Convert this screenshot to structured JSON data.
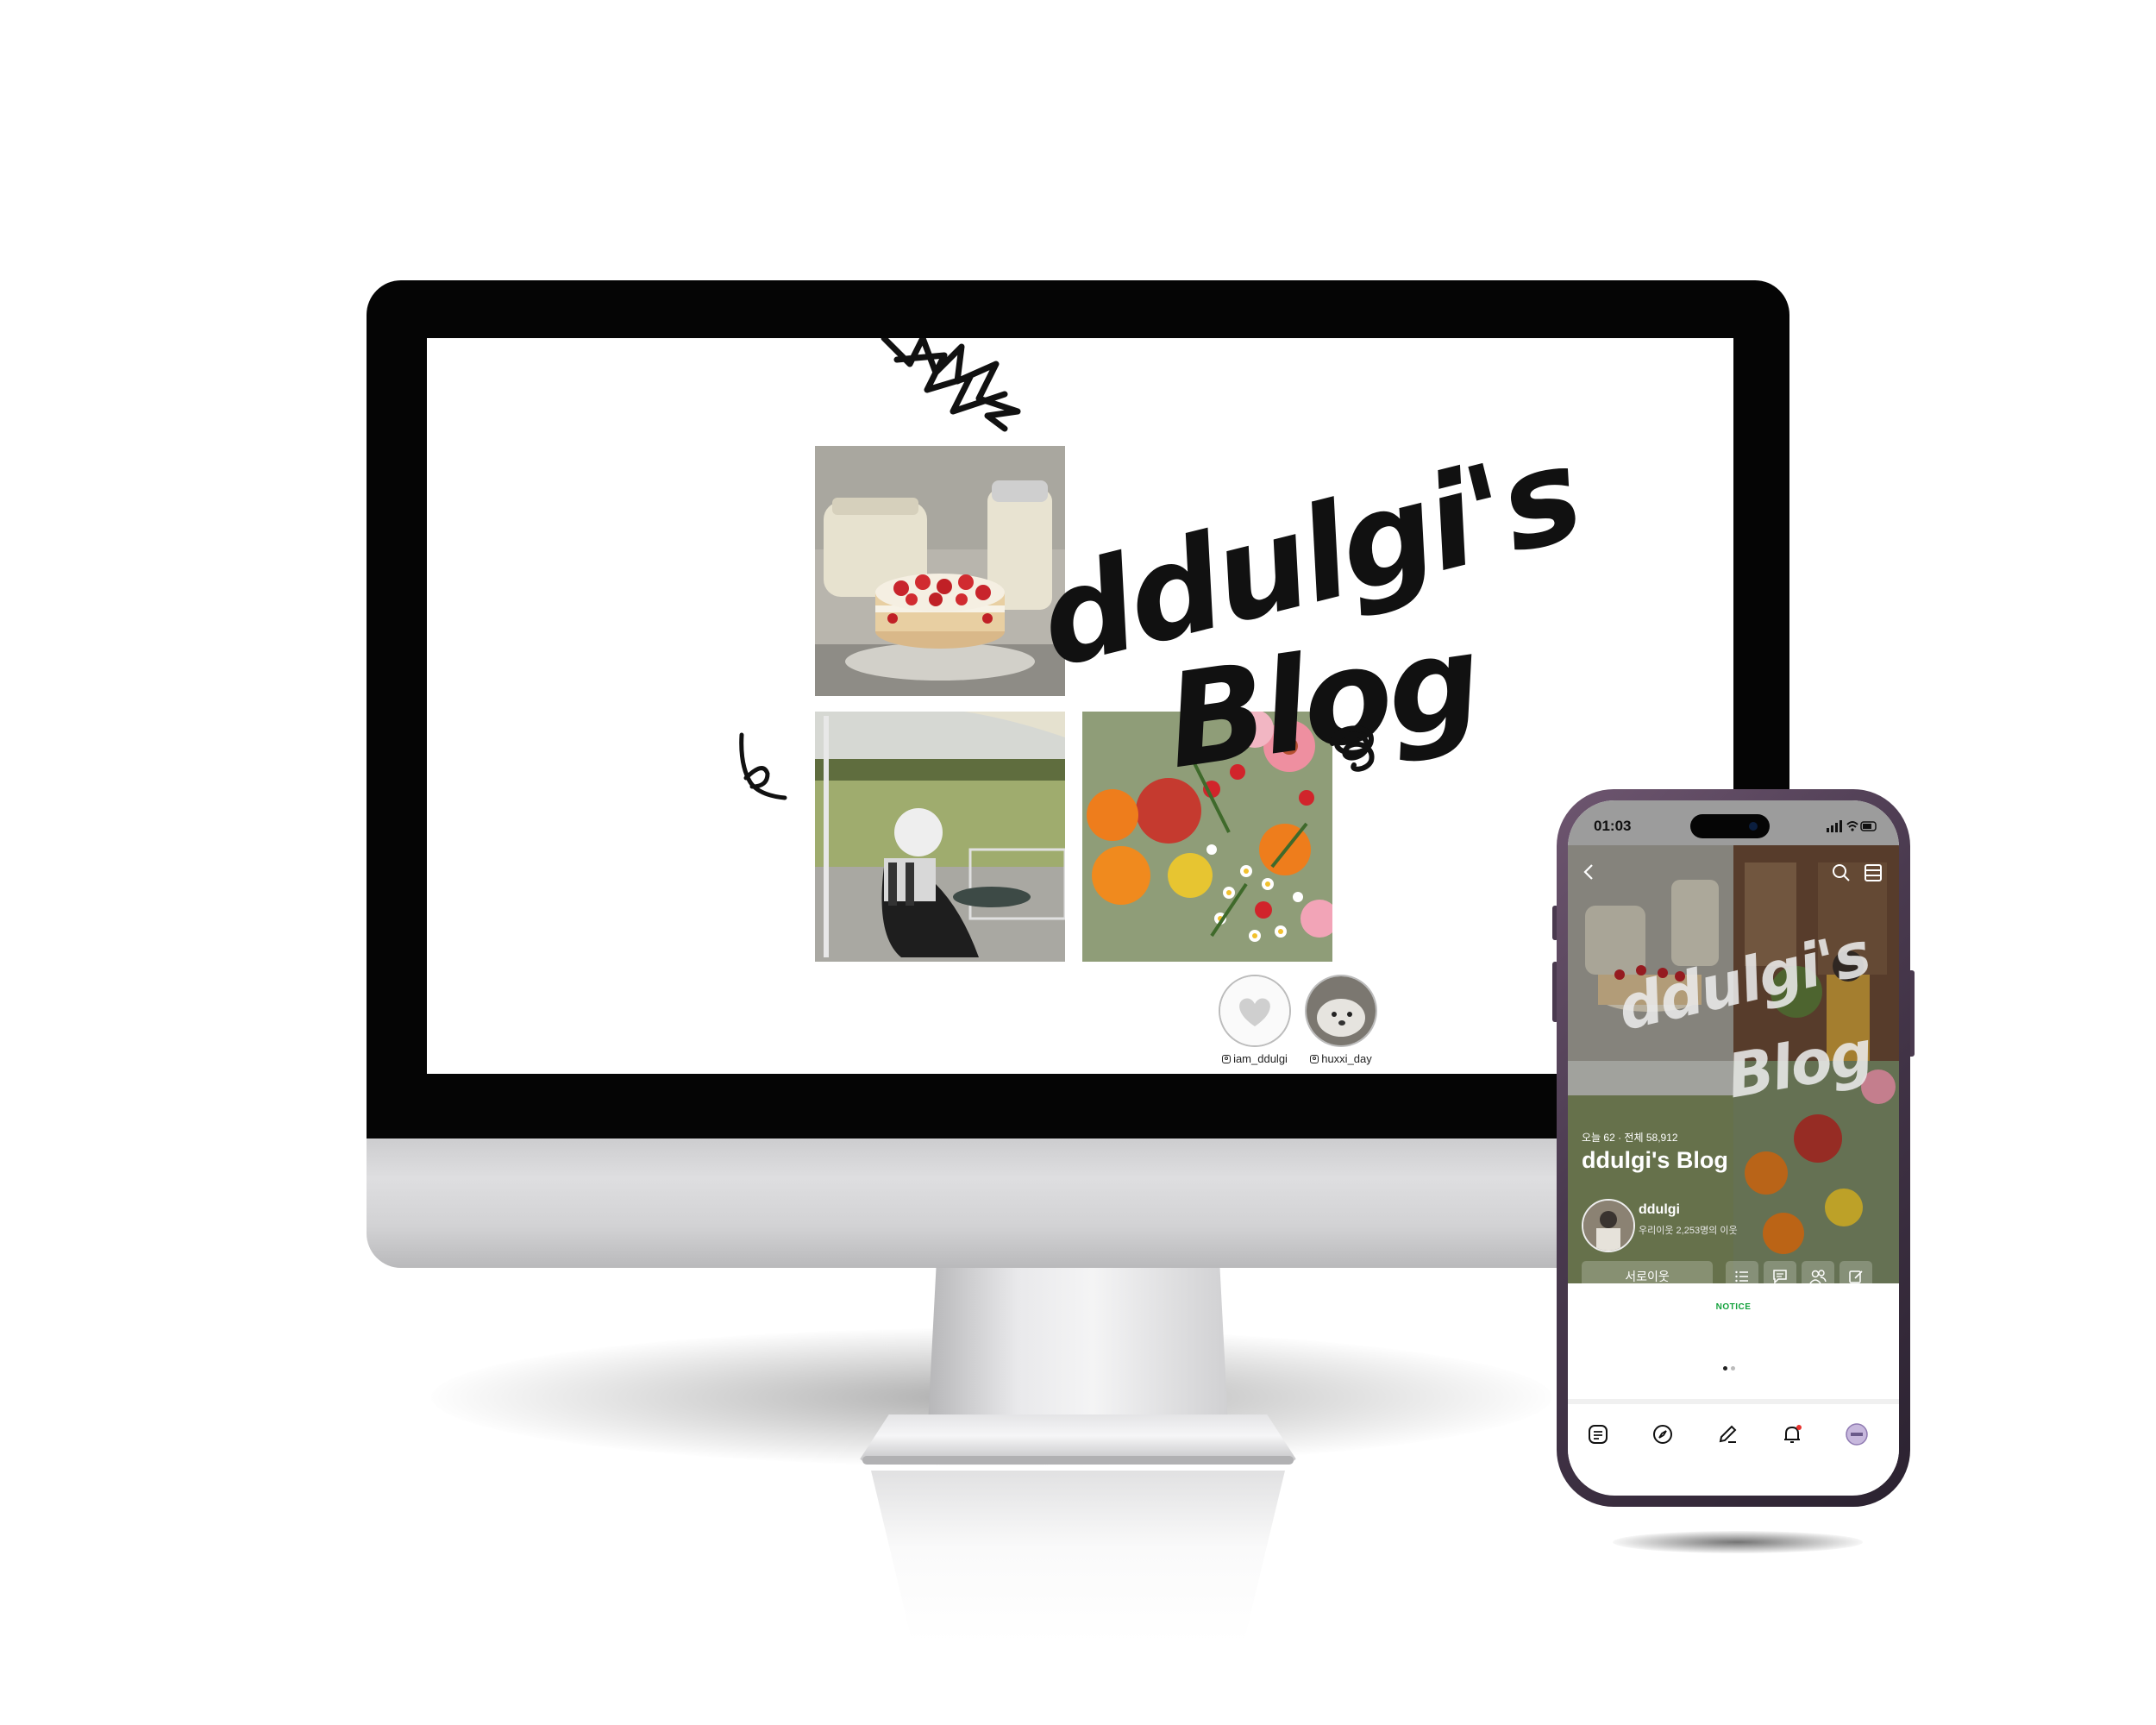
{
  "desktop": {
    "blog_title_line1": "ddulgi's",
    "blog_title_line2": "Blog",
    "instagram": [
      {
        "handle": "iam_ddulgi",
        "icon": "heart-avatar-icon"
      },
      {
        "handle": "huxxi_day",
        "icon": "dog-avatar-icon"
      }
    ],
    "photos": [
      "strawberry-cake-photo",
      "garden-cafe-photo",
      "fruit-flower-photo"
    ]
  },
  "phone": {
    "status_time": "01:03",
    "hero_title_line1": "ddulgi's",
    "hero_title_line2": "Blog",
    "visitors": "오늘 62 · 전체 58,912",
    "blog_name": "ddulgi's Blog",
    "nickname": "ddulgi",
    "neighbors": "우리이웃 2,253명의 이웃",
    "follow_button": "서로이웃",
    "notice_label": "NOTICE",
    "header_icons": [
      "back-icon",
      "search-icon",
      "menu-icon"
    ],
    "action_icons": [
      "list-icon",
      "comment-icon",
      "neighbors-icon",
      "write-icon"
    ],
    "tabbar_icons": [
      "feed-icon",
      "compass-icon",
      "pencil-icon",
      "bell-icon",
      "profile-icon"
    ]
  },
  "colors": {
    "phone_frame": "#4a3a4f",
    "notice_green": "#14a23d",
    "bezel": "#050505"
  }
}
